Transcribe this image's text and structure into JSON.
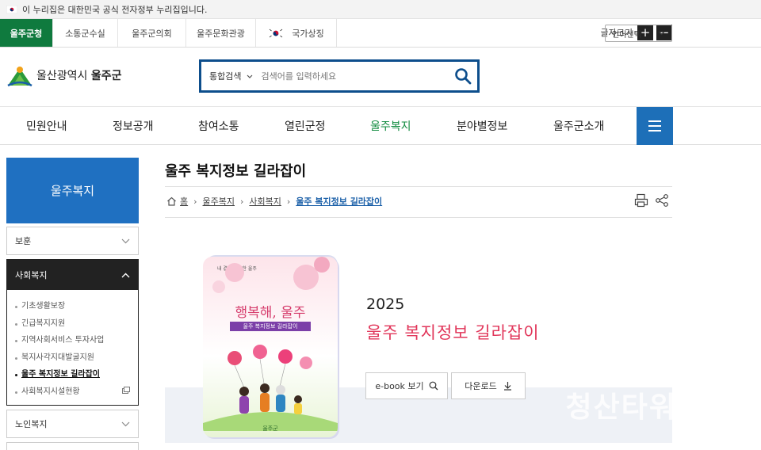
{
  "gov_banner": {
    "text": "이 누리집은 대한민국 공식 전자정부 누리집입니다."
  },
  "top_links": [
    {
      "label": "울주군청",
      "active": true
    },
    {
      "label": "소통군수실"
    },
    {
      "label": "울주군의회"
    },
    {
      "label": "울주문화관광"
    },
    {
      "label": "국가상징",
      "icon": "korea-flag-icon"
    }
  ],
  "font_size": {
    "label": "글자크기",
    "plus": "+",
    "minus": "−"
  },
  "language": {
    "label": "언어선택"
  },
  "logo": {
    "prefix": "울산광역시",
    "name": "울주군"
  },
  "search": {
    "scope": "통합검색",
    "placeholder": "검색어를 입력하세요",
    "icon": "search-icon"
  },
  "gnb": [
    {
      "label": "민원안내"
    },
    {
      "label": "정보공개"
    },
    {
      "label": "참여소통"
    },
    {
      "label": "열린군정"
    },
    {
      "label": "울주복지",
      "active": true
    },
    {
      "label": "분야별정보"
    },
    {
      "label": "울주군소개"
    }
  ],
  "sidebar": {
    "title": "울주복지",
    "items": [
      {
        "label": "보훈"
      },
      {
        "label": "사회복지"
      },
      {
        "label": "노인복지"
      }
    ],
    "sub_items": [
      {
        "label": "기초생활보장"
      },
      {
        "label": "긴급복지지원"
      },
      {
        "label": "지역사회서비스 투자사업"
      },
      {
        "label": "복지사각지대발굴지원"
      },
      {
        "label": "울주 복지정보 길라잡이",
        "active": true
      },
      {
        "label": "사회복지시설현황",
        "external": true
      }
    ]
  },
  "page": {
    "title": "울주 복지정보 길라잡이",
    "breadcrumb": [
      "홈",
      "울주복지",
      "사회복지",
      "울주 복지정보 길라잡이"
    ]
  },
  "ebook": {
    "year": "2025",
    "title": "울주 복지정보 길라잡이",
    "view_button": "e-book 보기",
    "download_button": "다운로드",
    "cover": {
      "small": "내 곁에 따뜻한 울주",
      "title": "행복해, 울주",
      "ribbon": "울주 복지정보 길라잡이",
      "footer": "울주군"
    },
    "watermark": "청산타워"
  },
  "colors": {
    "accent_green": "#0f7a3e",
    "primary_blue": "#1f70c1",
    "search_border": "#0d4e8c",
    "ebook_title": "#e1365a"
  }
}
